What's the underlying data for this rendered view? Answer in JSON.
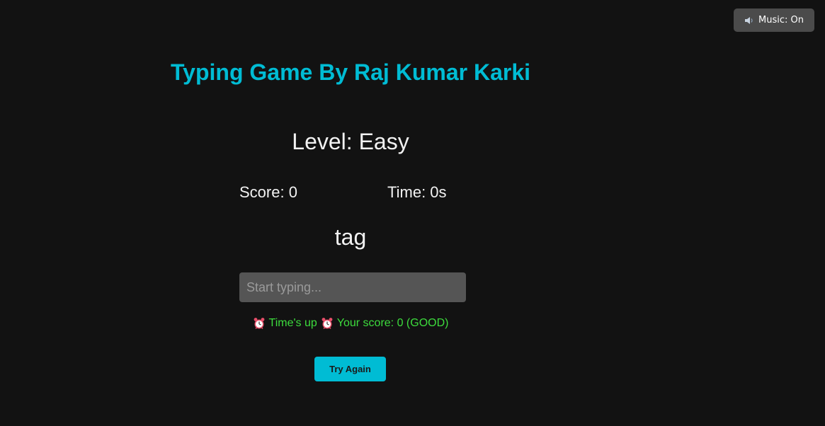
{
  "music_button": {
    "icon": "speaker-icon",
    "label": "Music: On"
  },
  "game": {
    "title": "Typing Game By Raj Kumar Karki",
    "level": "Level: Easy",
    "score": "Score: 0",
    "time": "Time: 0s",
    "current_word": "tag",
    "input": {
      "value": "",
      "placeholder": "Start typing..."
    },
    "result": {
      "icon": "alarm-clock-icon",
      "times_up": "Time's up",
      "score_message": "Your score: 0 (GOOD)"
    },
    "try_again_label": "Try Again"
  },
  "colors": {
    "background": "#121212",
    "accent": "#00bcd4",
    "result_text": "#3ddc3d",
    "input_bg": "#555555",
    "music_button_bg": "#4b4b4b"
  }
}
